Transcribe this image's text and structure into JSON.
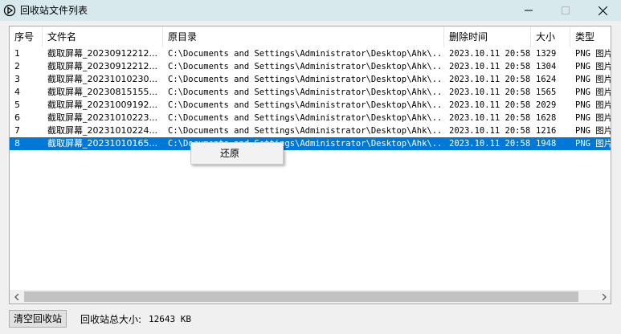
{
  "window": {
    "title": "回收站文件列表"
  },
  "columns": [
    {
      "key": "index",
      "label": "序号"
    },
    {
      "key": "name",
      "label": "文件名"
    },
    {
      "key": "origin",
      "label": "原目录"
    },
    {
      "key": "deleted",
      "label": "删除时间"
    },
    {
      "key": "size",
      "label": "大小"
    },
    {
      "key": "type",
      "label": "类型"
    }
  ],
  "rows": [
    {
      "index": "1",
      "name": "截取屏幕_20230912212...",
      "origin": "C:\\Documents and Settings\\Administrator\\Desktop\\Ahk\\...",
      "deleted": "2023.10.11 20:58",
      "size": "1329",
      "type": "PNG 图片"
    },
    {
      "index": "2",
      "name": "截取屏幕_20230912212...",
      "origin": "C:\\Documents and Settings\\Administrator\\Desktop\\Ahk\\...",
      "deleted": "2023.10.11 20:58",
      "size": "1304",
      "type": "PNG 图片"
    },
    {
      "index": "3",
      "name": "截取屏幕_20231010230...",
      "origin": "C:\\Documents and Settings\\Administrator\\Desktop\\Ahk\\...",
      "deleted": "2023.10.11 20:58",
      "size": "1624",
      "type": "PNG 图片"
    },
    {
      "index": "4",
      "name": "截取屏幕_20230815155...",
      "origin": "C:\\Documents and Settings\\Administrator\\Desktop\\Ahk\\...",
      "deleted": "2023.10.11 20:58",
      "size": "1565",
      "type": "PNG 图片"
    },
    {
      "index": "5",
      "name": "截取屏幕_20231009192...",
      "origin": "C:\\Documents and Settings\\Administrator\\Desktop\\Ahk\\...",
      "deleted": "2023.10.11 20:58",
      "size": "2029",
      "type": "PNG 图片"
    },
    {
      "index": "6",
      "name": "截取屏幕_20231010223...",
      "origin": "C:\\Documents and Settings\\Administrator\\Desktop\\Ahk\\...",
      "deleted": "2023.10.11 20:58",
      "size": "1628",
      "type": "PNG 图片"
    },
    {
      "index": "7",
      "name": "截取屏幕_20231010224...",
      "origin": "C:\\Documents and Settings\\Administrator\\Desktop\\Ahk\\...",
      "deleted": "2023.10.11 20:58",
      "size": "1216",
      "type": "PNG 图片"
    },
    {
      "index": "8",
      "name": "截取屏幕_20231010165...",
      "origin": "C:\\Documents and Settings\\Administrator\\Desktop\\Ahk\\...",
      "deleted": "2023.10.11 20:58",
      "size": "1948",
      "type": "PNG 图片",
      "selected": true
    }
  ],
  "context_menu": {
    "items": [
      "还原"
    ]
  },
  "footer": {
    "clear_button": "清空回收站",
    "total_label": "回收站总大小:",
    "total_value": "12643 KB"
  },
  "colors": {
    "titlebar": "#d8e9ee",
    "selection": "#0078d7",
    "window_bg": "#f0f0f0"
  }
}
